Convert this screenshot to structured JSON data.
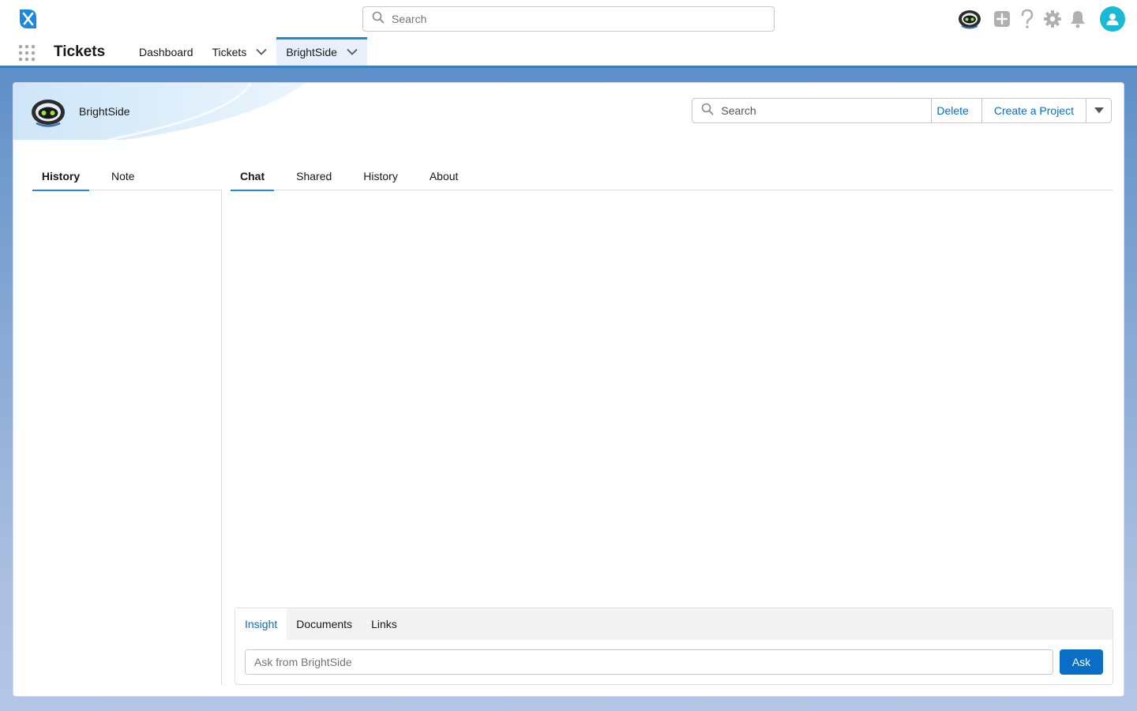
{
  "header": {
    "search_placeholder": "Search",
    "icons": [
      "logo-icon",
      "robot-avatar-icon",
      "plus-icon",
      "help-icon",
      "gear-icon",
      "bell-icon",
      "user-avatar-icon"
    ]
  },
  "nav": {
    "app_name": "Tickets",
    "items": [
      {
        "label": "Dashboard",
        "has_menu": false,
        "active": false
      },
      {
        "label": "Tickets",
        "has_menu": true,
        "active": false
      },
      {
        "label": "BrightSide",
        "has_menu": true,
        "active": true
      }
    ]
  },
  "record": {
    "title": "BrightSide",
    "search_placeholder": "Search",
    "delete_label": "Delete",
    "create_project_label": "Create a Project"
  },
  "left_tabs": [
    {
      "label": "History",
      "active": true
    },
    {
      "label": "Note",
      "active": false
    }
  ],
  "right_tabs": [
    {
      "label": "Chat",
      "active": true
    },
    {
      "label": "Shared",
      "active": false
    },
    {
      "label": "History",
      "active": false
    },
    {
      "label": "About",
      "active": false
    }
  ],
  "composer": {
    "tabs": [
      {
        "label": "Insight",
        "active": true
      },
      {
        "label": "Documents",
        "active": false
      },
      {
        "label": "Links",
        "active": false
      }
    ],
    "input_placeholder": "Ask from BrightSide",
    "ask_label": "Ask"
  },
  "colors": {
    "brand_blue": "#1b8ad8",
    "link_blue": "#0b6ec5",
    "avatar_teal": "#1ab9d6"
  }
}
